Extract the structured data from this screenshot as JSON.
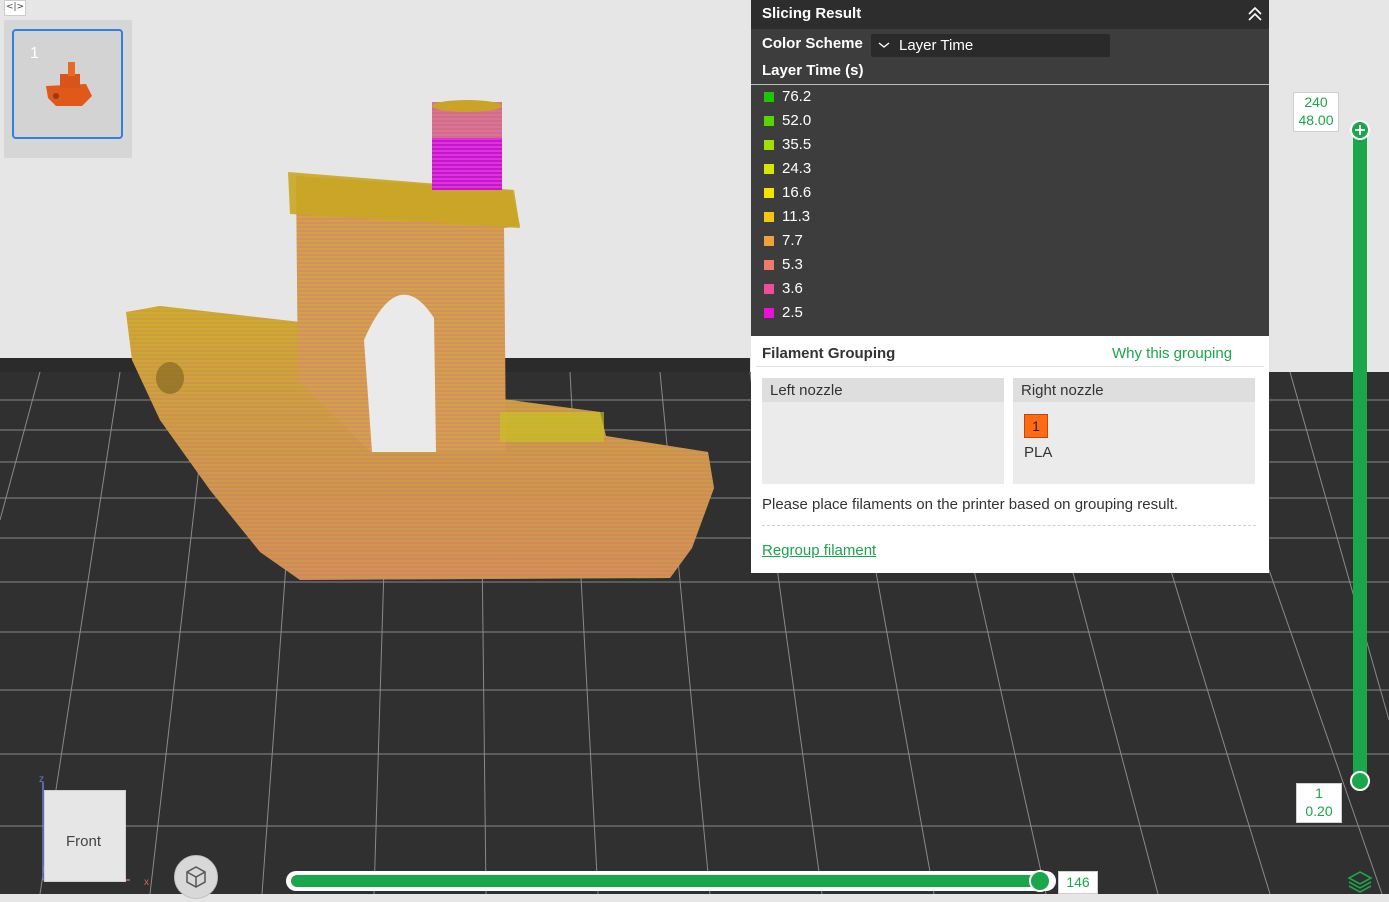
{
  "plate": {
    "number": "1"
  },
  "slicing_result": {
    "title": "Slicing Result",
    "color_scheme_label": "Color Scheme",
    "color_scheme_value": "Layer Time",
    "legend_title": "Layer Time (s)",
    "legend": [
      {
        "value": "76.2",
        "color": "#1ec500"
      },
      {
        "value": "52.0",
        "color": "#58d400"
      },
      {
        "value": "35.5",
        "color": "#a2e000"
      },
      {
        "value": "24.3",
        "color": "#d6e800"
      },
      {
        "value": "16.6",
        "color": "#f5e400"
      },
      {
        "value": "11.3",
        "color": "#f6c512"
      },
      {
        "value": "7.7",
        "color": "#f2a03c"
      },
      {
        "value": "5.3",
        "color": "#ee7a6a"
      },
      {
        "value": "3.6",
        "color": "#ec4f98"
      },
      {
        "value": "2.5",
        "color": "#ea10d8"
      }
    ]
  },
  "filament_grouping": {
    "title": "Filament Grouping",
    "why_link": "Why this grouping",
    "left_nozzle": "Left nozzle",
    "right_nozzle": "Right nozzle",
    "filament_number": "1",
    "filament_type": "PLA",
    "filament_color": "#ff6a13",
    "note": "Please place filaments on the printer based on grouping result.",
    "regroup_link": "Regroup filament"
  },
  "layer_slider": {
    "top_layer": "240",
    "top_height": "48.00",
    "bottom_layer": "1",
    "bottom_height": "0.20"
  },
  "move_slider": {
    "value": "146"
  },
  "view_cube": {
    "face": "Front"
  },
  "axes": {
    "z": "z",
    "x": "x"
  },
  "accent_color": "#1aa64a"
}
